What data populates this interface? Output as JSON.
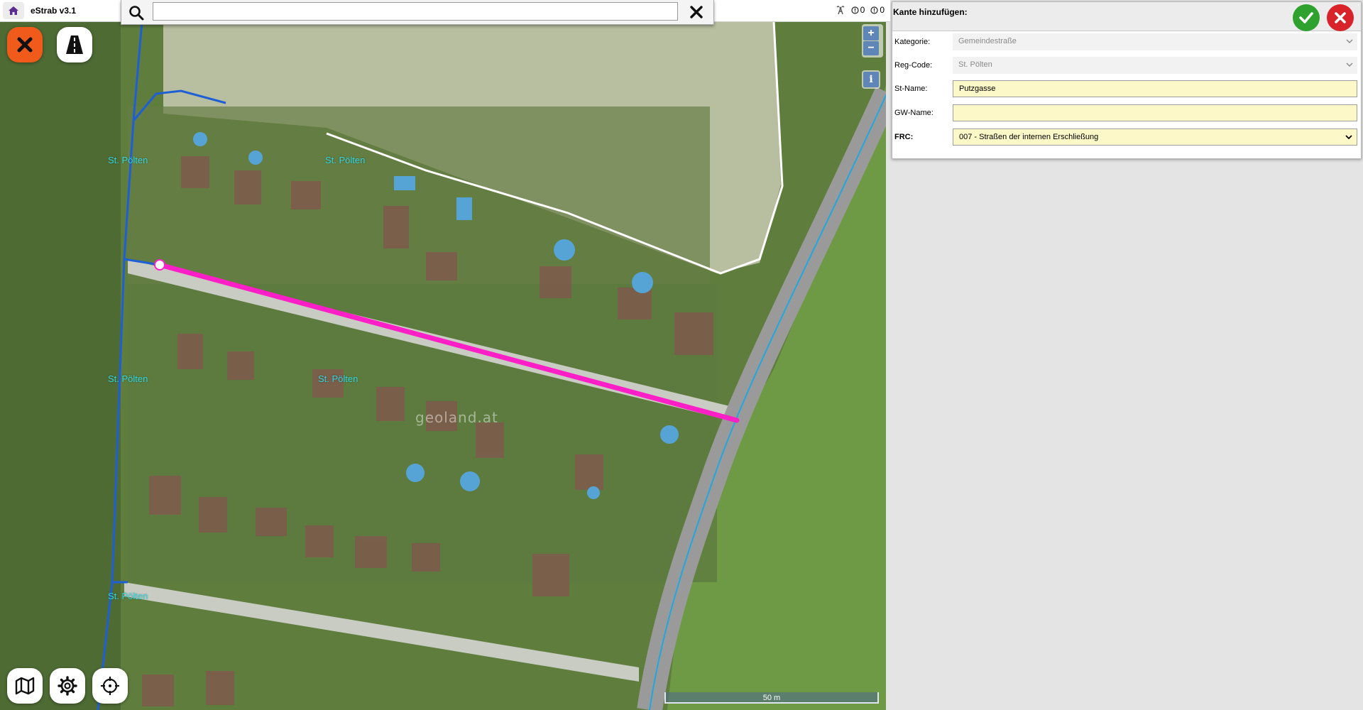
{
  "app": {
    "title": "eStrab v3.1"
  },
  "status": {
    "first_count": "0",
    "second_count": "0"
  },
  "search": {
    "value": "",
    "placeholder": ""
  },
  "map": {
    "labels": [
      "St. Pölten",
      "St. Pölten",
      "St. Pölten",
      "St. Pölten",
      "St. Pölten"
    ],
    "watermark": "geoland.at",
    "zoom_in": "+",
    "zoom_out": "−",
    "info": "i",
    "scale": "50 m"
  },
  "panel": {
    "title": "Kante hinzufügen:",
    "fields": {
      "kategorie": {
        "label": "Kategorie:",
        "value": "Gemeindestraße"
      },
      "reg_code": {
        "label": "Reg-Code:",
        "value": "St. Pölten"
      },
      "st_name": {
        "label": "St-Name:",
        "value": "Putzgasse"
      },
      "gw_name": {
        "label": "GW-Name:",
        "value": ""
      },
      "frc": {
        "label": "FRC:",
        "value": "007 - Straßen der internen Erschließung"
      }
    }
  },
  "colors": {
    "selected_edge": "#ff1fc6",
    "road_network": "#1f5fd6",
    "ok": "#2ea12e",
    "cancel": "#d8232a",
    "close_map": "#f05a1a"
  }
}
